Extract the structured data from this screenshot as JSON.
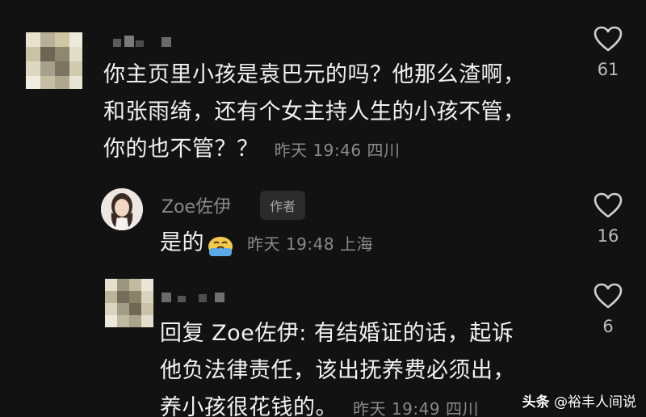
{
  "comments": [
    {
      "text_lines": [
        "你主页里小孩是袁巴元的吗？他那么渣啊，",
        "和张雨绮，还有个女主持人生的小孩不管，",
        "你的也不管？？"
      ],
      "meta": "昨天 19:46 四川",
      "likes": "61"
    },
    {
      "username": "Zoe佐伊",
      "badge": "作者",
      "text": "是的",
      "emoji": "crying-face-emoji",
      "meta": "昨天 19:48 上海",
      "likes": "16"
    },
    {
      "text_lines": [
        "回复 Zoe佐伊: 有结婚证的话，起诉",
        "他负法律责任，该出抚养费必须出，",
        "养小孩很花钱的。"
      ],
      "meta": "昨天 19:49 四川",
      "likes": "6"
    }
  ],
  "icons": {
    "like": "heart-outline-icon"
  },
  "watermark": {
    "logo": "头条",
    "handle": "@裕丰人间说"
  },
  "colors": {
    "background": "#121212",
    "text": "#f2f2f2",
    "meta": "#8a8a8a",
    "badge_bg": "#2b2b2b"
  }
}
